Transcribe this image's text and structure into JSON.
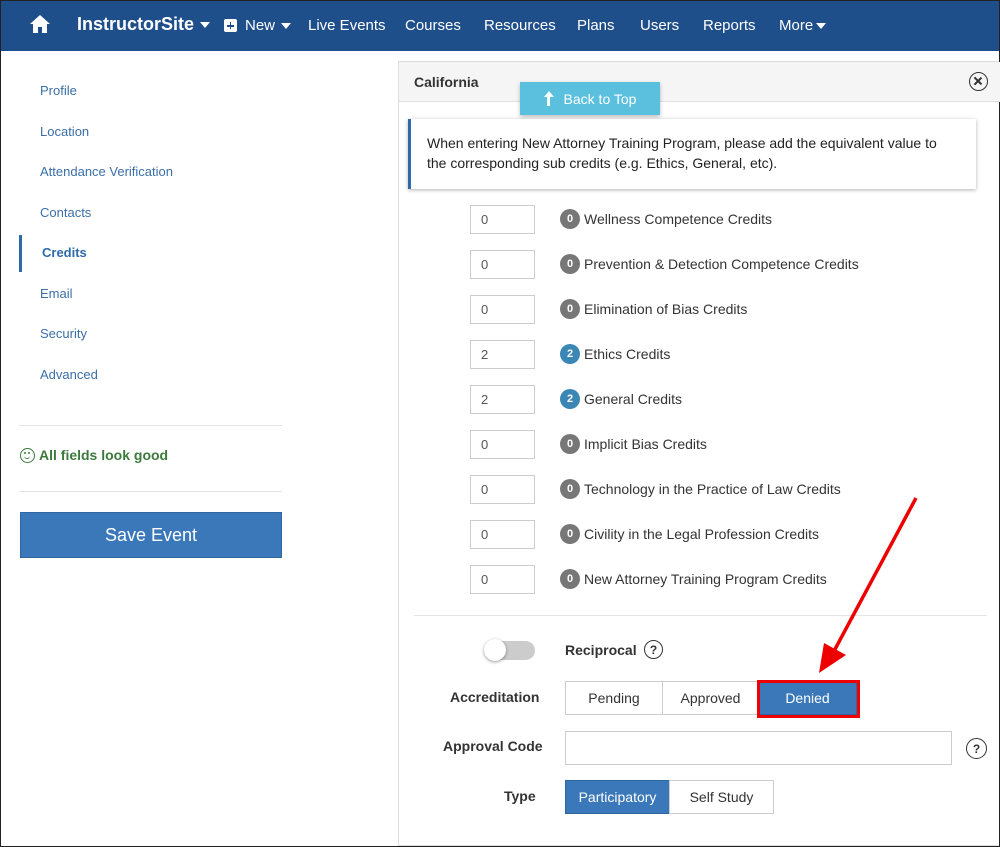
{
  "nav": {
    "brand": "InstructorSite",
    "new_label": "New",
    "items": [
      "Live Events",
      "Courses",
      "Resources",
      "Plans",
      "Users",
      "Reports",
      "More"
    ]
  },
  "sidebar": {
    "items": [
      "Profile",
      "Location",
      "Attendance Verification",
      "Contacts",
      "Credits",
      "Email",
      "Security",
      "Advanced"
    ],
    "active": "Credits",
    "status": "All fields look good",
    "save_label": "Save Event"
  },
  "panel": {
    "title": "California",
    "back_to_top": "Back to Top",
    "note": "When entering New Attorney Training Program, please add the equivalent value to the corresponding sub credits (e.g. Ethics, General, etc).",
    "credits": [
      {
        "value": "0",
        "badge": "0",
        "label": "Wellness Competence Credits"
      },
      {
        "value": "0",
        "badge": "0",
        "label": "Prevention & Detection Competence Credits"
      },
      {
        "value": "0",
        "badge": "0",
        "label": "Elimination of Bias Credits"
      },
      {
        "value": "2",
        "badge": "2",
        "label": "Ethics Credits"
      },
      {
        "value": "2",
        "badge": "2",
        "label": "General Credits"
      },
      {
        "value": "0",
        "badge": "0",
        "label": "Implicit Bias Credits"
      },
      {
        "value": "0",
        "badge": "0",
        "label": "Technology in the Practice of Law Credits"
      },
      {
        "value": "0",
        "badge": "0",
        "label": "Civility in the Legal Profession Credits"
      },
      {
        "value": "0",
        "badge": "0",
        "label": "New Attorney Training Program Credits"
      }
    ],
    "reciprocal_label": "Reciprocal",
    "reciprocal_on": false,
    "accreditation_label": "Accreditation",
    "accreditation_options": [
      "Pending",
      "Approved",
      "Denied"
    ],
    "accreditation_selected": "Denied",
    "approval_code_label": "Approval Code",
    "approval_code_value": "",
    "type_label": "Type",
    "type_options": [
      "Participatory",
      "Self Study"
    ],
    "type_selected": "Participatory",
    "help_glyph": "?"
  },
  "colors": {
    "nav_bg": "#1f4f8a",
    "primary": "#3a78ba",
    "info": "#5bc0de",
    "success": "#3c7a3c",
    "annotation": "#e00000"
  }
}
